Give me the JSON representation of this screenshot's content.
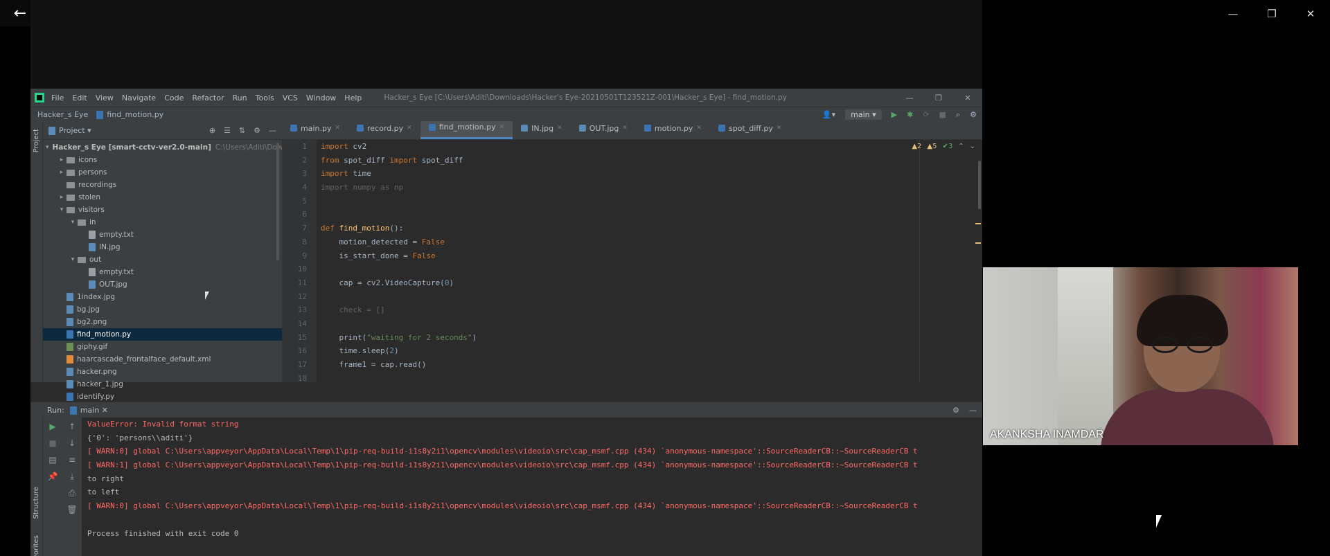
{
  "viewer": {
    "back_icon": "arrow-left-icon",
    "controls": [
      "—",
      "❐",
      "✕"
    ]
  },
  "ide": {
    "menu": [
      "File",
      "Edit",
      "View",
      "Navigate",
      "Code",
      "Refactor",
      "Run",
      "Tools",
      "VCS",
      "Window",
      "Help"
    ],
    "title_path": "Hacker_s Eye [C:\\Users\\Aditi\\Downloads\\Hacker's Eye-20210501T123521Z-001\\Hacker_s Eye] - find_motion.py",
    "window_controls": [
      "—",
      "❐",
      "✕"
    ],
    "breadcrumb": [
      "Hacker_s Eye",
      "find_motion.py"
    ],
    "run_config": "main",
    "project_label": "Project",
    "project_stripe_label": "Project",
    "tree": [
      {
        "label": "Hacker_s Eye [smart-cctv-ver2.0-main]",
        "hint": "C:\\Users\\Aditi\\Downlo",
        "type": "folder",
        "depth": 0,
        "arrow": "▾"
      },
      {
        "label": "icons",
        "type": "folder",
        "depth": 1,
        "arrow": "▸"
      },
      {
        "label": "persons",
        "type": "folder",
        "depth": 1,
        "arrow": "▸"
      },
      {
        "label": "recordings",
        "type": "folder",
        "depth": 1,
        "arrow": ""
      },
      {
        "label": "stolen",
        "type": "folder",
        "depth": 1,
        "arrow": "▸"
      },
      {
        "label": "visitors",
        "type": "folder",
        "depth": 1,
        "arrow": "▾"
      },
      {
        "label": "in",
        "type": "folder",
        "depth": 2,
        "arrow": "▾"
      },
      {
        "label": "empty.txt",
        "type": "txt",
        "depth": 3,
        "arrow": ""
      },
      {
        "label": "IN.jpg",
        "type": "img",
        "depth": 3,
        "arrow": ""
      },
      {
        "label": "out",
        "type": "folder",
        "depth": 2,
        "arrow": "▾"
      },
      {
        "label": "empty.txt",
        "type": "txt",
        "depth": 3,
        "arrow": ""
      },
      {
        "label": "OUT.jpg",
        "type": "img",
        "depth": 3,
        "arrow": ""
      },
      {
        "label": "1index.jpg",
        "type": "img",
        "depth": 1,
        "arrow": ""
      },
      {
        "label": "bg.jpg",
        "type": "img",
        "depth": 1,
        "arrow": ""
      },
      {
        "label": "bg2.png",
        "type": "img",
        "depth": 1,
        "arrow": ""
      },
      {
        "label": "find_motion.py",
        "type": "py",
        "depth": 1,
        "arrow": "",
        "selected": true
      },
      {
        "label": "giphy.gif",
        "type": "gif",
        "depth": 1,
        "arrow": ""
      },
      {
        "label": "haarcascade_frontalface_default.xml",
        "type": "xml",
        "depth": 1,
        "arrow": ""
      },
      {
        "label": "hacker.png",
        "type": "img",
        "depth": 1,
        "arrow": ""
      },
      {
        "label": "hacker_1.jpg",
        "type": "img",
        "depth": 1,
        "arrow": ""
      },
      {
        "label": "identify.py",
        "type": "py",
        "depth": 1,
        "arrow": ""
      }
    ],
    "tabs": [
      {
        "label": "main.py",
        "icon": "py"
      },
      {
        "label": "record.py",
        "icon": "py"
      },
      {
        "label": "find_motion.py",
        "icon": "py",
        "active": true
      },
      {
        "label": "IN.jpg",
        "icon": "img"
      },
      {
        "label": "OUT.jpg",
        "icon": "img"
      },
      {
        "label": "motion.py",
        "icon": "py"
      },
      {
        "label": "spot_diff.py",
        "icon": "py"
      }
    ],
    "inspections": {
      "warnings": "▲2",
      "weak": "▲5",
      "ok": "✔3"
    },
    "line_numbers": [
      "1",
      "2",
      "3",
      "4",
      "5",
      "6",
      "7",
      "8",
      "9",
      "10",
      "11",
      "12",
      "13",
      "14",
      "15",
      "16",
      "17",
      "18"
    ],
    "code": [
      [
        {
          "t": "import",
          "c": "kw"
        },
        {
          "t": " cv2",
          "c": ""
        }
      ],
      [
        {
          "t": "from",
          "c": "kw"
        },
        {
          "t": " spot_diff ",
          "c": ""
        },
        {
          "t": "import",
          "c": "kw"
        },
        {
          "t": " spot_diff",
          "c": ""
        }
      ],
      [
        {
          "t": "import",
          "c": "kw"
        },
        {
          "t": " time",
          "c": ""
        }
      ],
      [
        {
          "t": "import numpy as np",
          "c": "unused"
        }
      ],
      [],
      [],
      [
        {
          "t": "def ",
          "c": "kw"
        },
        {
          "t": "find_motion",
          "c": "fn"
        },
        {
          "t": "():",
          "c": ""
        }
      ],
      [
        {
          "t": "    motion_detected = ",
          "c": ""
        },
        {
          "t": "False",
          "c": "kw"
        }
      ],
      [
        {
          "t": "    is_start_done = ",
          "c": ""
        },
        {
          "t": "False",
          "c": "kw"
        }
      ],
      [],
      [
        {
          "t": "    cap = cv2.VideoCapture(",
          "c": ""
        },
        {
          "t": "0",
          "c": "num"
        },
        {
          "t": ")",
          "c": ""
        }
      ],
      [],
      [
        {
          "t": "    check = []",
          "c": "unused"
        }
      ],
      [],
      [
        {
          "t": "    print(",
          "c": ""
        },
        {
          "t": "\"waiting for 2 seconds\"",
          "c": "str"
        },
        {
          "t": ")",
          "c": ""
        }
      ],
      [
        {
          "t": "    time.sleep(",
          "c": ""
        },
        {
          "t": "2",
          "c": "num"
        },
        {
          "t": ")",
          "c": ""
        }
      ],
      [
        {
          "t": "    frame1 = cap.read()",
          "c": ""
        }
      ],
      []
    ],
    "run_label": "Run:",
    "run_config_tab": "main",
    "console": [
      {
        "text": "ValueError: Invalid format string",
        "c": "err"
      },
      {
        "text": "{'0': 'persons\\\\aditi'}",
        "c": "normal"
      },
      {
        "text": "[ WARN:0] global C:\\Users\\appveyor\\AppData\\Local\\Temp\\1\\pip-req-build-i1s8y2i1\\opencv\\modules\\videoio\\src\\cap_msmf.cpp (434) `anonymous-namespace'::SourceReaderCB::~SourceReaderCB t",
        "c": "err"
      },
      {
        "text": "[ WARN:1] global C:\\Users\\appveyor\\AppData\\Local\\Temp\\1\\pip-req-build-i1s8y2i1\\opencv\\modules\\videoio\\src\\cap_msmf.cpp (434) `anonymous-namespace'::SourceReaderCB::~SourceReaderCB t",
        "c": "err"
      },
      {
        "text": "to right",
        "c": "normal"
      },
      {
        "text": "to left",
        "c": "normal"
      },
      {
        "text": "[ WARN:0] global C:\\Users\\appveyor\\AppData\\Local\\Temp\\1\\pip-req-build-i1s8y2i1\\opencv\\modules\\videoio\\src\\cap_msmf.cpp (434) `anonymous-namespace'::SourceReaderCB::~SourceReaderCB t",
        "c": "err"
      },
      {
        "text": "",
        "c": "normal"
      },
      {
        "text": "Process finished with exit code 0",
        "c": "normal"
      }
    ],
    "structure_label": "Structure",
    "favorites_label": "Favorites"
  },
  "webcam": {
    "name": "AKANKSHA INAMDAR"
  }
}
